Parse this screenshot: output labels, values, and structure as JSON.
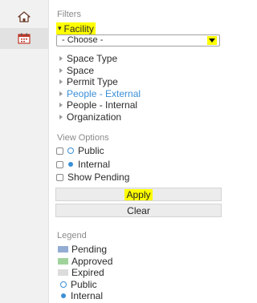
{
  "nav": {
    "items": [
      {
        "icon": "home-icon",
        "active": false
      },
      {
        "icon": "calendar-icon",
        "active": true
      }
    ]
  },
  "filters": {
    "title": "Filters",
    "facility_label": "Facility",
    "select_value": "- Choose -",
    "tree": [
      "Space Type",
      "Space",
      "Permit Type",
      "People - External",
      "People - Internal",
      "Organization"
    ]
  },
  "view_options": {
    "title": "View Options",
    "public_label": "Public",
    "internal_label": "Internal",
    "show_pending_label": "Show Pending"
  },
  "buttons": {
    "apply": "Apply",
    "clear": "Clear"
  },
  "legend": {
    "title": "Legend",
    "pending": "Pending",
    "approved": "Approved",
    "expired": "Expired",
    "public": "Public",
    "internal": "Internal"
  },
  "colors": {
    "highlight": "#ffff00",
    "link": "#3a8fd6",
    "pending": "#93acd3",
    "approved": "#9fd39b",
    "expired": "#dcdcdc"
  }
}
